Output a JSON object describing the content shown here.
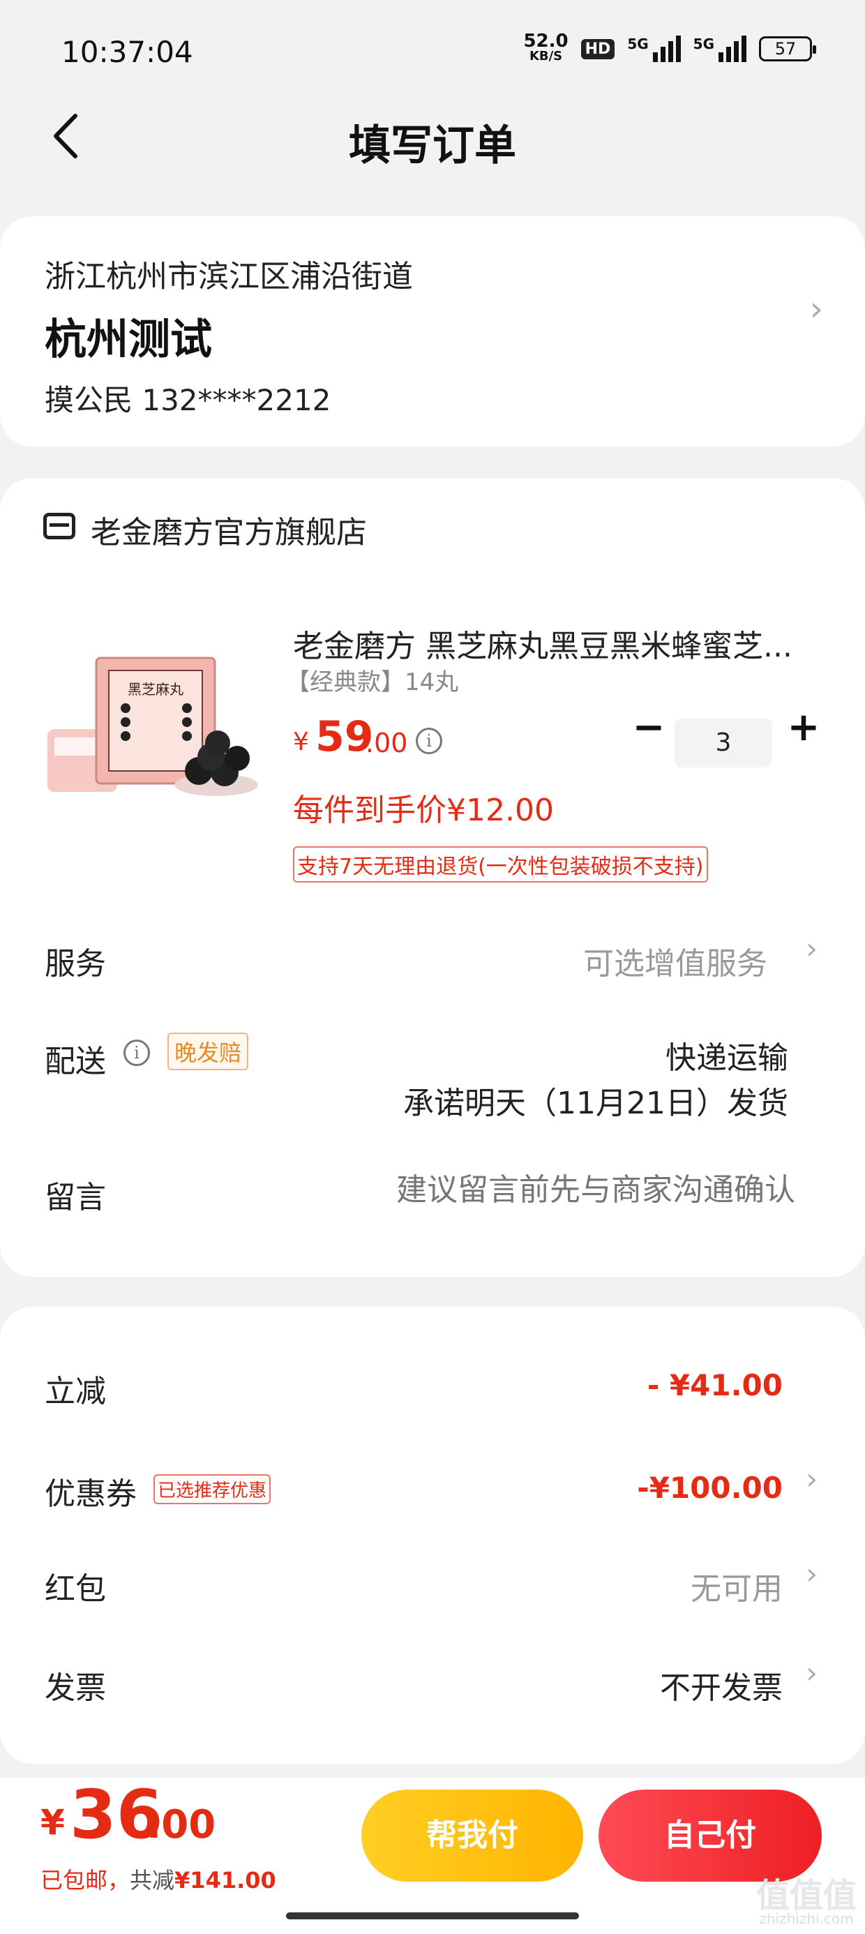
{
  "status_bar": {
    "time": "10:37:04",
    "net_speed": "52.0",
    "net_unit": "KB/S",
    "hd": "HD",
    "sig1": "5G",
    "sig2": "5G",
    "battery": "57"
  },
  "header": {
    "title": "填写订单"
  },
  "address": {
    "region": "浙江杭州市滨江区浦沿街道",
    "detail": "杭州测试",
    "contact": "摸公民  132****2212"
  },
  "shop": {
    "name": "老金磨方官方旗舰店"
  },
  "product": {
    "title": "老金磨方 黑芝麻丸黑豆黑米蜂蜜芝...",
    "sku": "【经典款】14丸",
    "price_currency": "¥",
    "price_int": "59",
    "price_dec": ".00",
    "each_price": "每件到手价¥12.00",
    "return_policy": "支持7天无理由退货(一次性包装破损不支持)",
    "quantity": "3",
    "box_text": "黑芝麻丸"
  },
  "rows": {
    "service_label": "服务",
    "service_value": "可选增值服务",
    "delivery_label": "配送",
    "late_tag": "晚发赔",
    "ship_method": "快递运输",
    "ship_date": "承诺明天（11月21日）发货",
    "message_label": "留言",
    "message_placeholder": "建议留言前先与商家沟通确认"
  },
  "discounts": {
    "reduce_label": "立减",
    "reduce_value": "- ¥41.00",
    "coupon_label": "优惠券",
    "coupon_tag": "已选推荐优惠",
    "coupon_value": "-¥100.00",
    "redpacket_label": "红包",
    "redpacket_value": "无可用",
    "invoice_label": "发票",
    "invoice_value": "不开发票"
  },
  "footer": {
    "currency": "¥",
    "total_int": "36",
    "total_dec": ".00",
    "free_shipping": "已包邮，",
    "saved_label": "共减",
    "saved_value": "¥141.00",
    "help_pay": "帮我付",
    "self_pay": "自己付",
    "watermark": "值值值",
    "watermark_url": "zhizhizhi.com"
  },
  "colors": {
    "accent": "#e62b15",
    "help_button": "#ffc21a",
    "self_button": "#f22d33"
  }
}
